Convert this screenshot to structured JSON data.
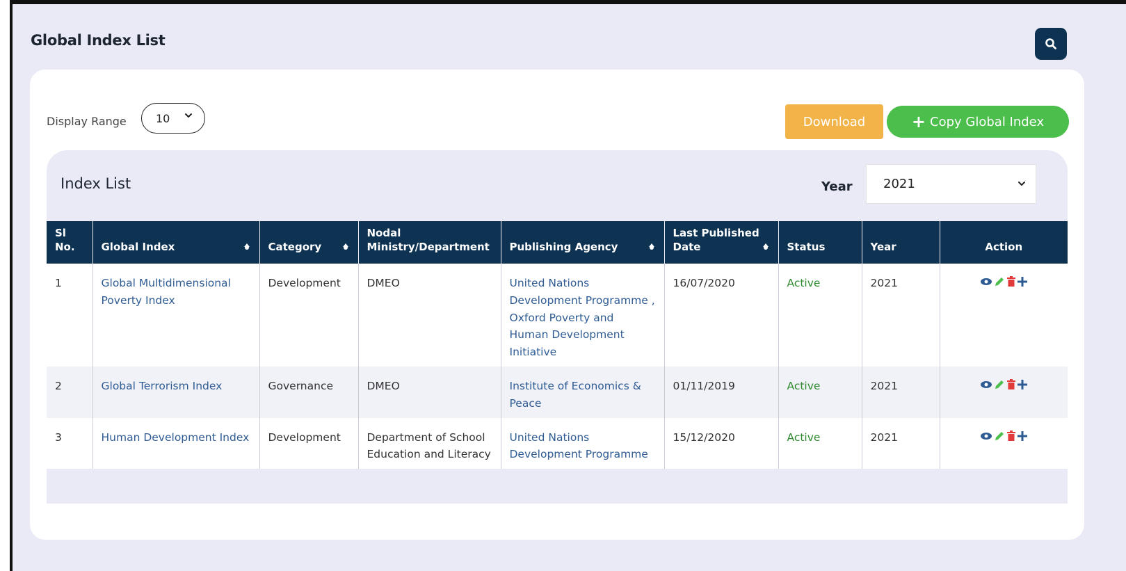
{
  "page": {
    "title": "Global Index List",
    "search_icon": "search-icon"
  },
  "toolbar": {
    "display_range_label": "Display Range",
    "display_range_value": "10",
    "download_label": "Download",
    "copy_label": "Copy Global Index"
  },
  "index_list": {
    "title": "Index List",
    "year_label": "Year",
    "year_value": "2021"
  },
  "table": {
    "headers": {
      "sl_no": "Sl No.",
      "global_index": "Global Index",
      "category": "Category",
      "nodal": "Nodal Ministry/Department",
      "agency": "Publishing Agency",
      "date": "Last Published Date",
      "status": "Status",
      "year": "Year",
      "action": "Action"
    },
    "rows": [
      {
        "sl": "1",
        "index": "Global Multidimensional Poverty Index",
        "category": "Development",
        "nodal": "DMEO",
        "agency": "United Nations Development Programme , Oxford Poverty and Human Development Initiative",
        "date": "16/07/2020",
        "status": "Active",
        "year": "2021"
      },
      {
        "sl": "2",
        "index": "Global Terrorism Index",
        "category": "Governance",
        "nodal": "DMEO",
        "agency": "Institute of Economics & Peace",
        "date": "01/11/2019",
        "status": "Active",
        "year": "2021"
      },
      {
        "sl": "3",
        "index": "Human Development Index",
        "category": "Development",
        "nodal": "Department of School Education and Literacy",
        "agency": "United Nations Development Programme",
        "date": "15/12/2020",
        "status": "Active",
        "year": "2021"
      }
    ]
  },
  "colors": {
    "header_bg": "#0d3252",
    "download": "#f2b349",
    "copy": "#4bbe4b",
    "status_active": "#2f8a2f",
    "link": "#2f5b93"
  }
}
